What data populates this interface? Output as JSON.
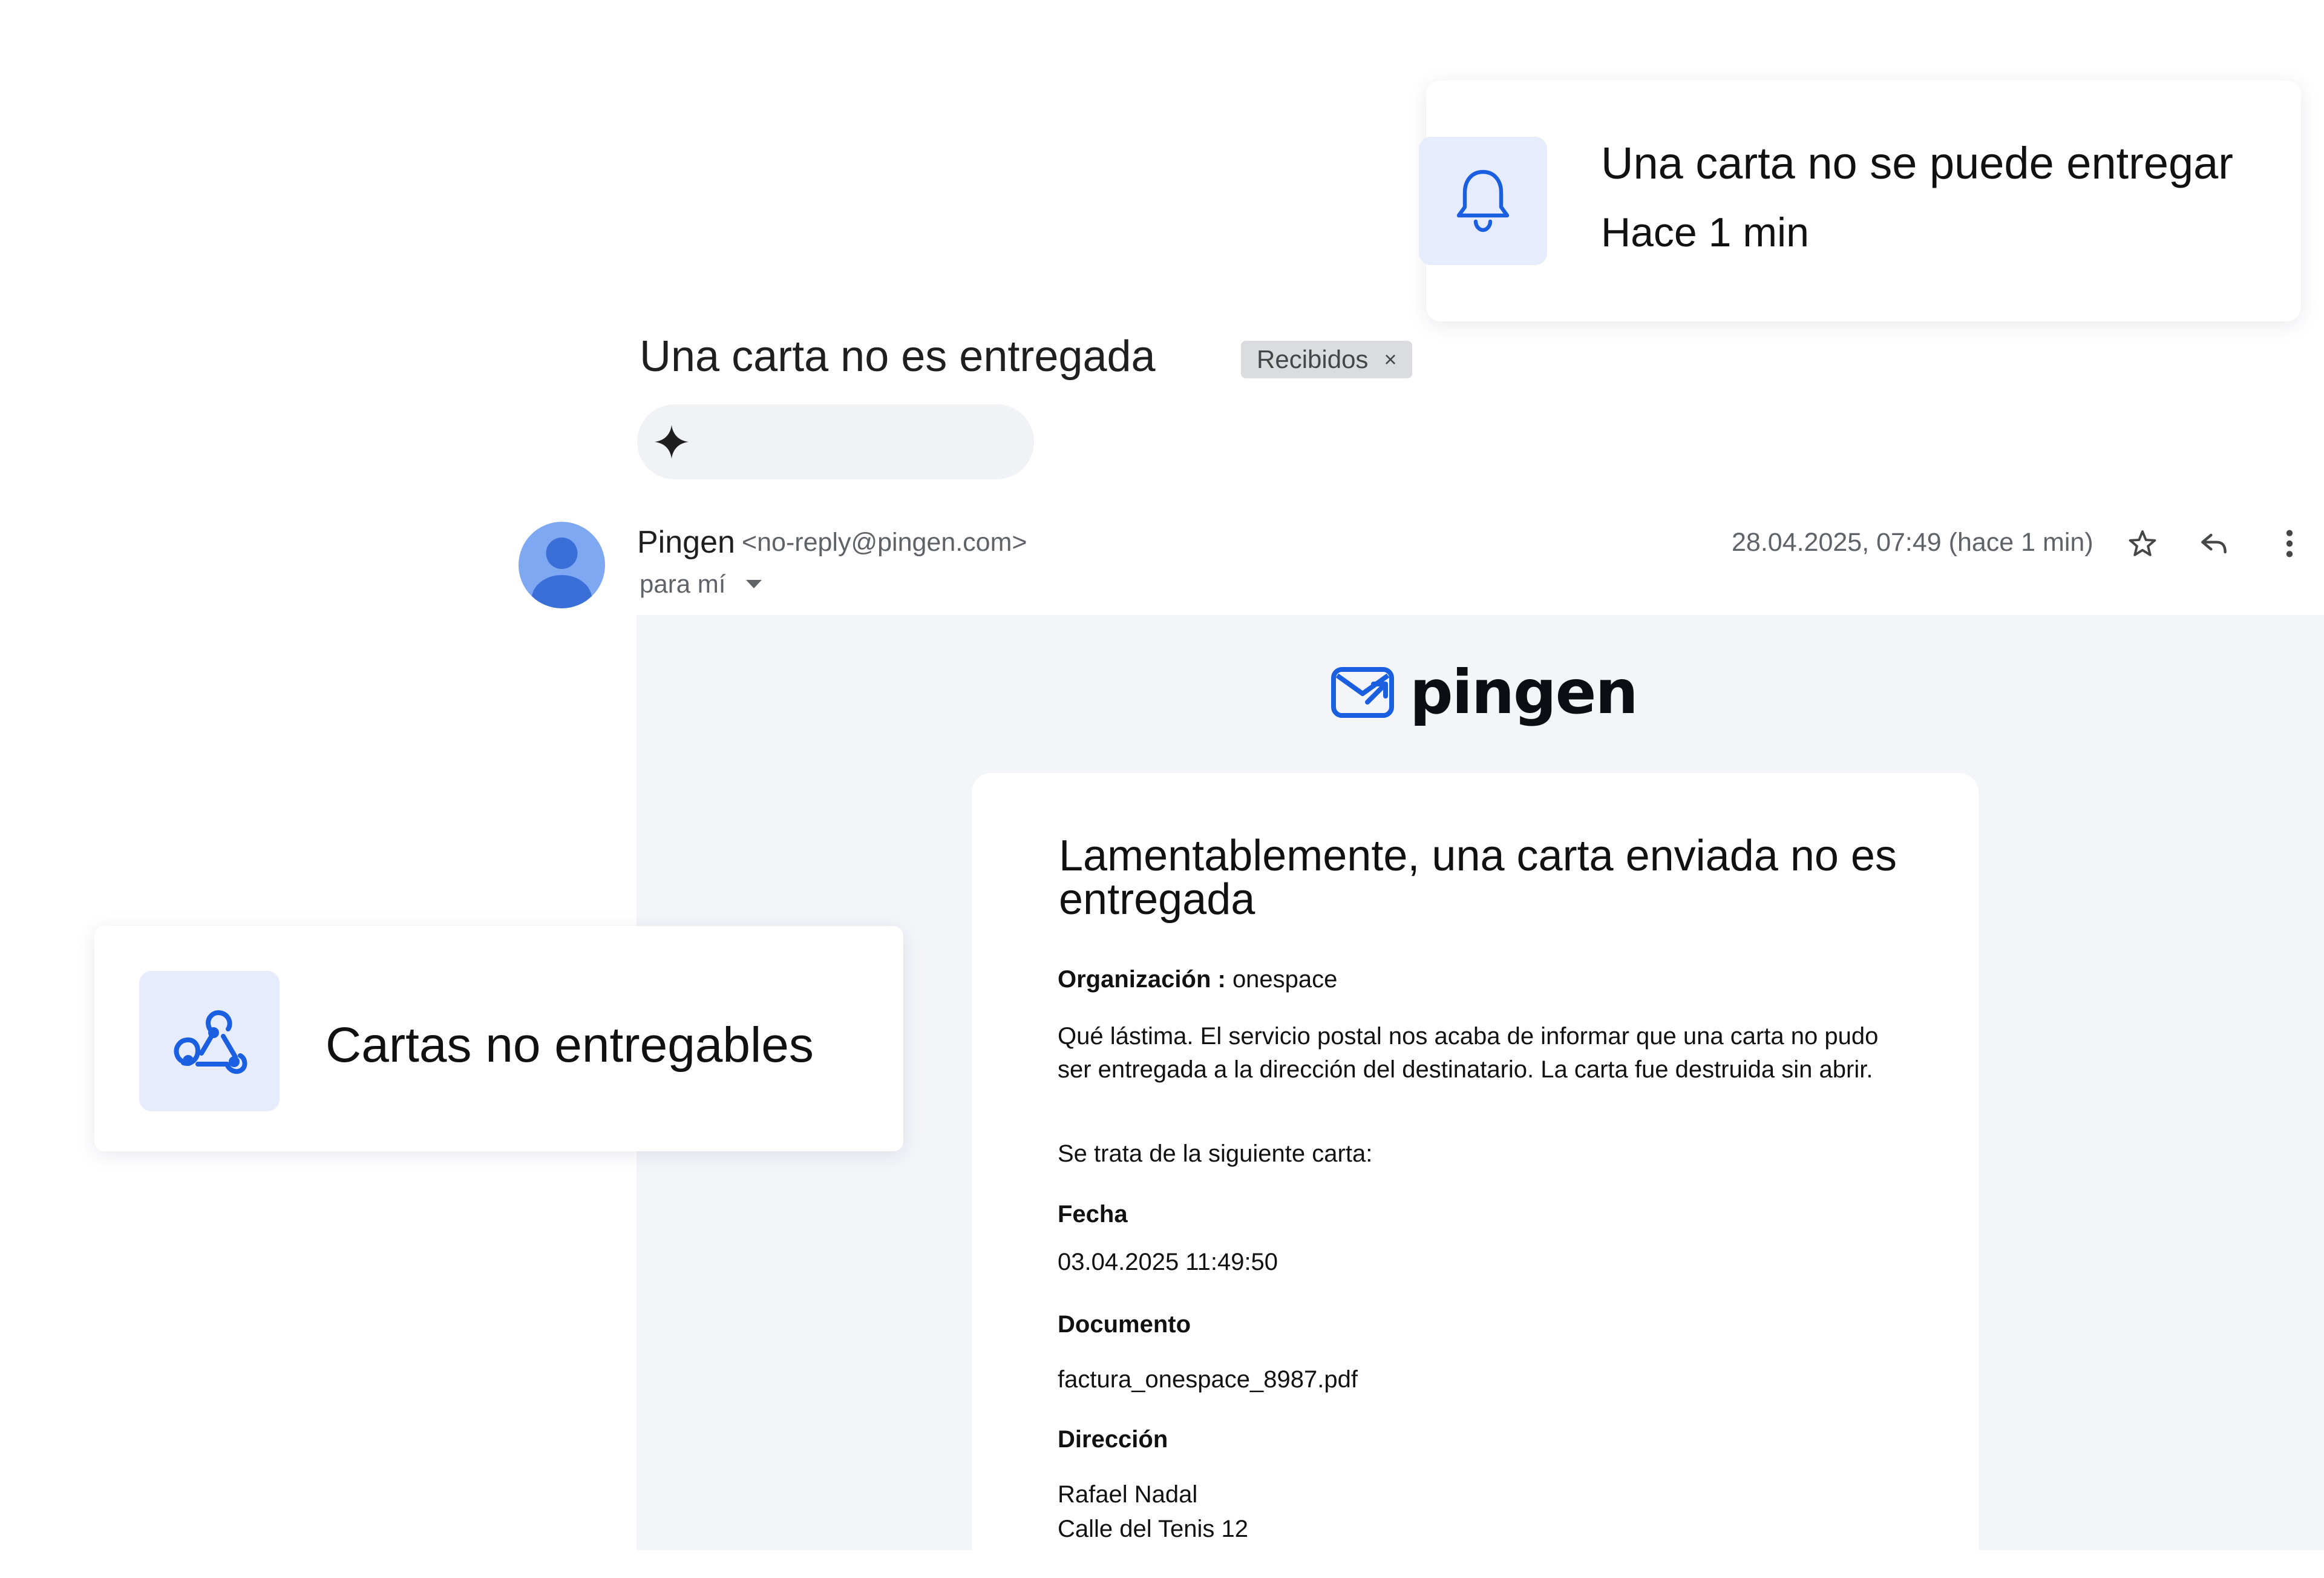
{
  "notification": {
    "icon": "bell-icon",
    "title": "Una carta no se puede entregar",
    "time": "Hace 1 min"
  },
  "email": {
    "subject": "Una carta no es entregada",
    "label": "Recibidos",
    "label_close": "×",
    "gemini_icon": "sparkle-icon",
    "sender_name": "Pingen",
    "sender_email": "<no-reply@pingen.com>",
    "to": "para mí",
    "date": "28.04.2025, 07:49 (hace 1 min)"
  },
  "message": {
    "brand": "pingen",
    "heading": "Lamentablemente, una carta enviada no es entregada",
    "org_label": "Organización :",
    "org_value": "onespace",
    "paragraph_line1": "Qué lástima. El servicio postal nos acaba de informar que una carta no pudo",
    "paragraph_line2": "ser entregada a la dirección del destinatario. La carta fue destruida sin abrir.",
    "intro": "Se trata de la siguiente carta:",
    "fecha_label": "Fecha",
    "fecha_value": "03.04.2025 11:49:50",
    "documento_label": "Documento",
    "documento_value": "factura_onespace_8987.pdf",
    "direccion_label": "Dirección",
    "address_line1": "Rafael Nadal",
    "address_line2": "Calle del Tenis 12"
  },
  "webhook_card": {
    "icon": "webhook-icon",
    "title": "Cartas no entregables"
  },
  "colors": {
    "accent": "#1a5fe0",
    "icon_bg": "#e6ecfb",
    "mail_bg": "#f4f5f9",
    "avatar": "#7fa8f3"
  }
}
